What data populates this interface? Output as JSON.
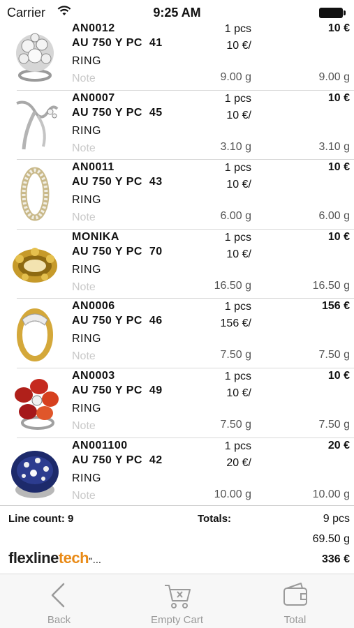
{
  "status": {
    "carrier": "Carrier",
    "time": "9:25 AM"
  },
  "items": [
    {
      "code": "AN0012",
      "alloy": "AU 750 Y PC  41",
      "type": "RING",
      "note_placeholder": "Note",
      "qty": "1 pcs",
      "unit_price": "10 €/",
      "weight": "9.00 g",
      "total_price": "10 €",
      "total_weight": "9.00 g",
      "image": "ring-diamond-cluster"
    },
    {
      "code": "AN0007",
      "alloy": "AU 750 Y PC  45",
      "type": "RING",
      "note_placeholder": "Note",
      "qty": "1 pcs",
      "unit_price": "10 €/",
      "weight": "3.10 g",
      "total_price": "10 €",
      "total_weight": "3.10 g",
      "image": "ring-silver-twist"
    },
    {
      "code": "AN0011",
      "alloy": "AU 750 Y PC  43",
      "type": "RING",
      "note_placeholder": "Note",
      "qty": "1 pcs",
      "unit_price": "10 €/",
      "weight": "6.00 g",
      "total_price": "10 €",
      "total_weight": "6.00 g",
      "image": "ring-eternity-band"
    },
    {
      "code": "MONIKA",
      "alloy": "AU 750 Y PC  70",
      "type": "RING",
      "note_placeholder": "Note",
      "qty": "1 pcs",
      "unit_price": "10 €/",
      "weight": "16.50 g",
      "total_price": "10 €",
      "total_weight": "16.50 g",
      "image": "ring-gold-chunky"
    },
    {
      "code": "AN0006",
      "alloy": "AU 750 Y PC  46",
      "type": "RING",
      "note_placeholder": "Note",
      "qty": "1 pcs",
      "unit_price": "156 €/",
      "weight": "7.50 g",
      "total_price": "156 €",
      "total_weight": "7.50 g",
      "image": "ring-gold-pave"
    },
    {
      "code": "AN0003",
      "alloy": "AU 750 Y PC  49",
      "type": "RING",
      "note_placeholder": "Note",
      "qty": "1 pcs",
      "unit_price": "10 €/",
      "weight": "7.50 g",
      "total_price": "10 €",
      "total_weight": "7.50 g",
      "image": "ring-red-flower"
    },
    {
      "code": "AN001100",
      "alloy": "AU 750 Y PC  42",
      "type": "RING",
      "note_placeholder": "Note",
      "qty": "1 pcs",
      "unit_price": "20 €/",
      "weight": "10.00 g",
      "total_price": "20 €",
      "total_weight": "10.00 g",
      "image": "ring-blue-enamel"
    }
  ],
  "summary": {
    "line_count": "Line count: 9",
    "totals_label": "Totals:",
    "total_pcs": "9 pcs",
    "total_weight": "69.50 g",
    "total_price": "336 €"
  },
  "logo": {
    "part1": "flexline",
    "part2": "tech",
    "suffix": "\"..."
  },
  "tabbar": {
    "back": "Back",
    "empty_cart": "Empty Cart",
    "total": "Total"
  },
  "colors": {
    "logo_accent": "#e98a16",
    "tab_inactive": "#9a9a9a"
  }
}
